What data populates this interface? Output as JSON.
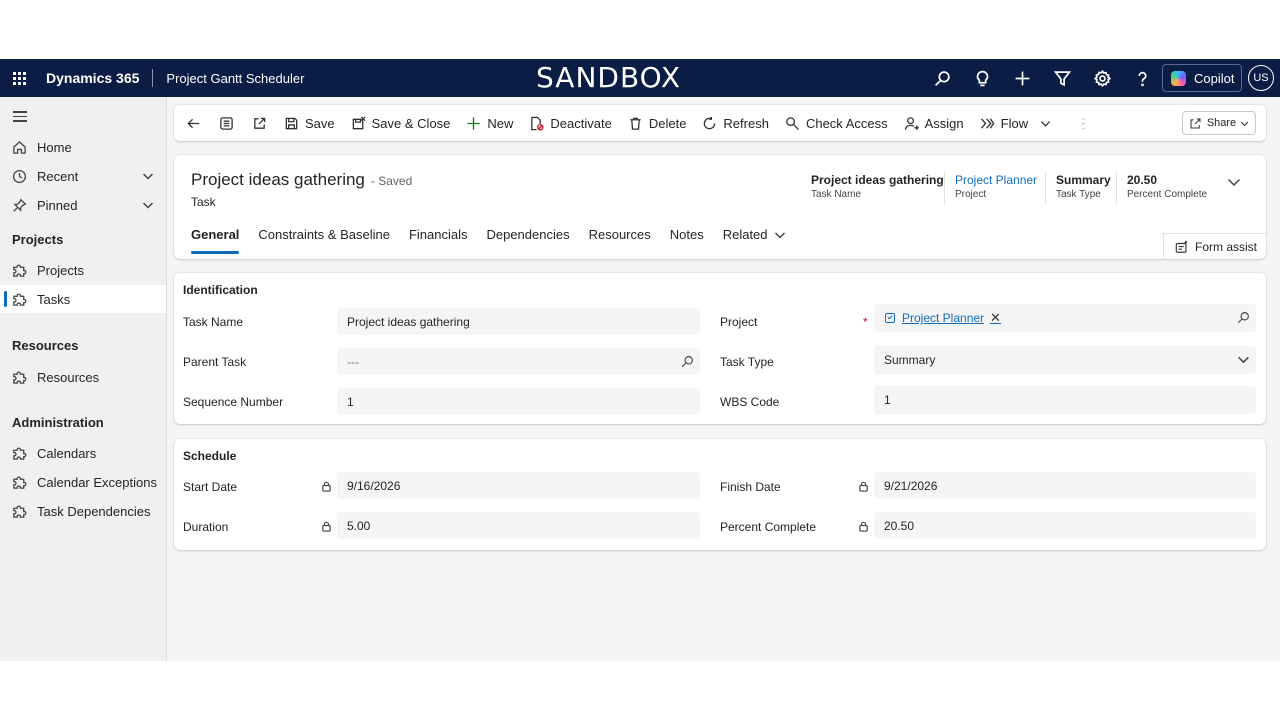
{
  "topbar": {
    "brand": "Dynamics 365",
    "app_name": "Project Gantt Scheduler",
    "environment_banner": "SANDBOX",
    "icons": [
      "search-icon",
      "lightbulb-icon",
      "plus-icon",
      "filter-icon",
      "settings-icon",
      "help-icon"
    ],
    "copilot_label": "Copilot",
    "avatar_initials": "US"
  },
  "sidebar": {
    "home": "Home",
    "recent": "Recent",
    "pinned": "Pinned",
    "group_projects": "Projects",
    "projects": "Projects",
    "tasks": "Tasks",
    "group_resources": "Resources",
    "resources": "Resources",
    "group_administration": "Administration",
    "calendars": "Calendars",
    "calendar_exceptions": "Calendar Exceptions",
    "task_dependencies": "Task Dependencies"
  },
  "commandbar": {
    "save": "Save",
    "save_close": "Save & Close",
    "new": "New",
    "deactivate": "Deactivate",
    "delete": "Delete",
    "refresh": "Refresh",
    "check_access": "Check Access",
    "assign": "Assign",
    "flow": "Flow",
    "share": "Share"
  },
  "record": {
    "title": "Project ideas gathering",
    "status": "- Saved",
    "entity": "Task",
    "header_fields": [
      {
        "value": "Project ideas gathering",
        "label": "Task Name"
      },
      {
        "value": "Project Planner",
        "label": "Project"
      },
      {
        "value": "Summary",
        "label": "Task Type"
      },
      {
        "value": "20.50",
        "label": "Percent Complete"
      }
    ]
  },
  "tabs": {
    "general": "General",
    "constraints": "Constraints & Baseline",
    "financials": "Financials",
    "dependencies": "Dependencies",
    "resources": "Resources",
    "notes": "Notes",
    "related": "Related"
  },
  "form_assist": "Form assist",
  "identification": {
    "title": "Identification",
    "task_name_label": "Task Name",
    "task_name_value": "Project ideas gathering",
    "parent_task_label": "Parent Task",
    "parent_task_value": "---",
    "sequence_label": "Sequence Number",
    "sequence_value": "1",
    "project_label": "Project",
    "project_required": "*",
    "project_value": "Project Planner",
    "task_type_label": "Task Type",
    "task_type_value": "Summary",
    "wbs_label": "WBS Code",
    "wbs_value": "1"
  },
  "schedule": {
    "title": "Schedule",
    "start_label": "Start Date",
    "start_value": "9/16/2026",
    "duration_label": "Duration",
    "duration_value": "5.00",
    "finish_label": "Finish Date",
    "finish_value": "9/21/2026",
    "percent_label": "Percent Complete",
    "percent_value": "20.50"
  },
  "colors": {
    "topbar_bg": "#0b1d45",
    "accent": "#0f6cbd",
    "required": "#c50f1f"
  }
}
